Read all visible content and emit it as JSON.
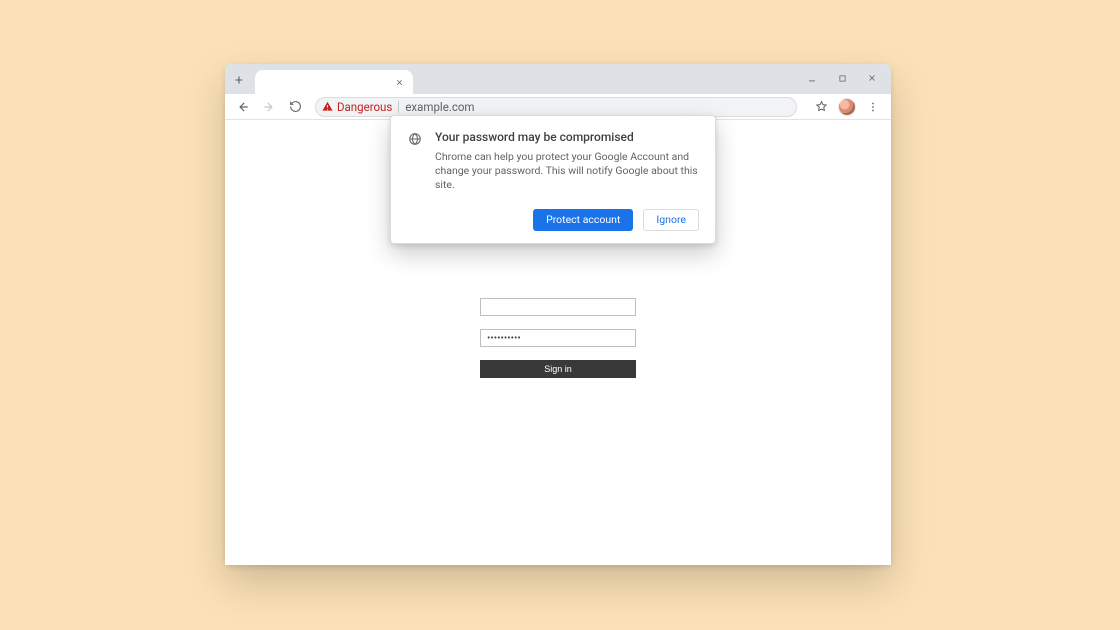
{
  "window": {
    "minimize_tip": "Minimize",
    "maximize_tip": "Maximize",
    "close_tip": "Close"
  },
  "tabstrip": {
    "newtab_tip": "New Tab",
    "active_tab_title": "",
    "close_tab_tip": "Close tab"
  },
  "toolbar": {
    "back_tip": "Back",
    "forward_tip": "Forward",
    "reload_tip": "Reload",
    "security_label": "Dangerous",
    "url": "example.com",
    "star_tip": "Bookmark this tab",
    "profile_tip": "You",
    "menu_tip": "Customize and control"
  },
  "popover": {
    "title": "Your password may be compromised",
    "body": "Chrome can help you protect your Google Account and change your password. This will notify Google about this site.",
    "primary_label": "Protect account",
    "secondary_label": "Ignore"
  },
  "form": {
    "username_value": "",
    "password_mask": "••••••••••",
    "submit_label": "Sign in"
  }
}
